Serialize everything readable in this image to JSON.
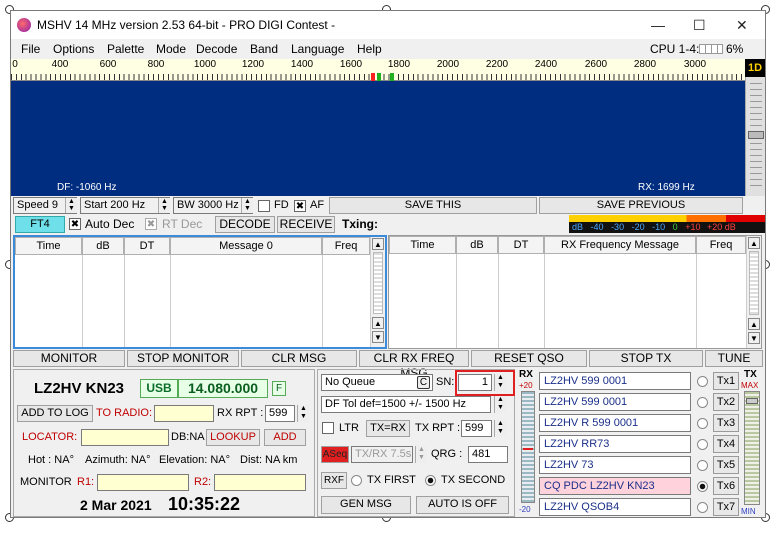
{
  "window": {
    "title": "MSHV 14 MHz version 2.53 64-bit  - PRO DIGI Contest -",
    "minimize": "—",
    "maximize": "☐",
    "close": "✕"
  },
  "menu": [
    "File",
    "Options",
    "Palette",
    "Mode",
    "Decode",
    "Band",
    "Language",
    "Help"
  ],
  "cpu": "CPU 1-4:",
  "cpu_pct": "6%",
  "mode_indicator": "1D",
  "ruler_labels": [
    "0",
    "400",
    "600",
    "800",
    "1000",
    "1200",
    "1400",
    "1600",
    "1800",
    "2000",
    "2200",
    "2400",
    "2600",
    "2800",
    "3000"
  ],
  "waterfall": {
    "df": "DF: -1060 Hz",
    "rx": "RX: 1699 Hz"
  },
  "controls": {
    "speed": "Speed 9",
    "start": "Start 200 Hz",
    "bw": "BW 3000 Hz",
    "fd": "FD",
    "af": "AF",
    "save_this": "SAVE THIS",
    "save_previous": "SAVE PREVIOUS"
  },
  "mode_row": {
    "mode": "FT4",
    "auto_dec": "Auto Dec",
    "rt_dec": "RT Dec",
    "decode": "DECODE",
    "receive": "RECEIVE",
    "txing": "Txing:"
  },
  "meter_labels": [
    "dB",
    "-40",
    "-30",
    "-20",
    "-10",
    "0",
    "+10",
    "+20 dB"
  ],
  "left_table": {
    "cols": [
      "Time",
      "dB",
      "DT",
      "Message 0",
      "Freq"
    ]
  },
  "right_table": {
    "cols": [
      "Time",
      "dB",
      "DT",
      "RX Frequency Message",
      "Freq"
    ]
  },
  "action_buttons": [
    "MONITOR",
    "STOP MONITOR",
    "CLR MSG",
    "CLR RX FREQ MSG",
    "RESET QSO",
    "STOP TX",
    "TUNE"
  ],
  "station": {
    "call_loc": "LZ2HV KN23",
    "mode": "USB",
    "freq": "14.080.000",
    "f": "F"
  },
  "log": {
    "add_to_log": "ADD TO LOG",
    "to_radio": "TO RADIO:",
    "rx_rpt": "RX RPT :",
    "rx_rpt_val": "599",
    "locator": "LOCATOR:",
    "db": "DB:NA",
    "lookup": "LOOKUP",
    "add": "ADD",
    "hot": "Hot : NA°",
    "azimuth": "Azimuth: NA°",
    "elevation": "Elevation: NA°",
    "dist": "Dist: NA km",
    "monitor": "MONITOR",
    "r1": "R1:",
    "r2": "R2:"
  },
  "datetime": {
    "date": "2 Mar 2021",
    "time": "10:35:22"
  },
  "mid": {
    "queue": "No Queue",
    "c": "C",
    "sn": "SN:",
    "sn_val": "1",
    "df_tol": "DF Tol def=1500 +/-  1500  Hz",
    "ltr": "LTR",
    "tx_rx": "TX=RX",
    "tx_rpt": "TX RPT :",
    "tx_rpt_val": "599",
    "aseq": "ASeq",
    "txrx_time": "TX/RX 7.5s",
    "qrg": "QRG :",
    "qrg_val": "481",
    "rxf": "RXF",
    "tx_first": "TX FIRST",
    "tx_second": "TX SECOND",
    "gen_msg": "GEN MSG",
    "auto_is_off": "AUTO IS OFF"
  },
  "rx_meter": {
    "label": "RX",
    "top": "+20",
    "bottom": "-20"
  },
  "tx_messages": [
    {
      "msg": "LZ2HV 599 0001",
      "btn": "Tx1"
    },
    {
      "msg": "LZ2HV 599 0001",
      "btn": "Tx2"
    },
    {
      "msg": "LZ2HV R 599 0001",
      "btn": "Tx3"
    },
    {
      "msg": "LZ2HV RR73",
      "btn": "Tx4"
    },
    {
      "msg": "LZ2HV 73",
      "btn": "Tx5"
    },
    {
      "msg": "CQ PDC LZ2HV KN23",
      "btn": "Tx6"
    },
    {
      "msg": "LZ2HV QSOB4",
      "btn": "Tx7"
    }
  ],
  "tx_meter": {
    "label": "TX",
    "max": "MAX",
    "min": "MIN"
  },
  "colors": {
    "waterfall": "#002d80",
    "accent_blue": "#1a2f8a",
    "highlight_red": "#e02020",
    "ft4": "#6fe0ea",
    "tx6_bg": "#ffd2dc"
  }
}
